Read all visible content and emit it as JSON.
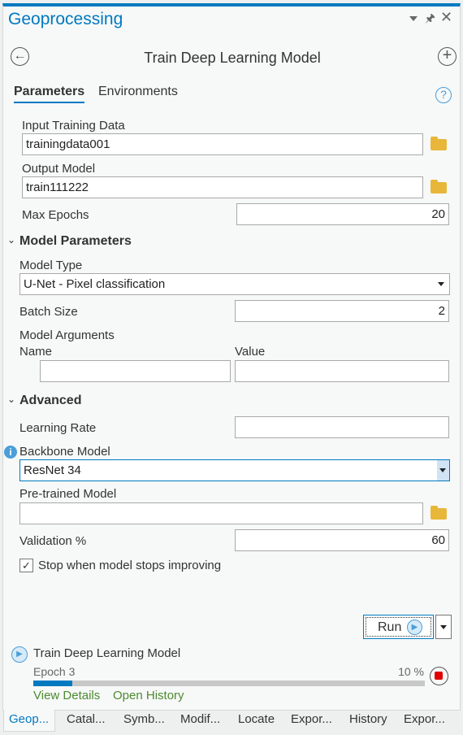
{
  "pane": {
    "title": "Geoprocessing"
  },
  "tool": {
    "title": "Train Deep Learning Model"
  },
  "tabs": {
    "parameters": "Parameters",
    "environments": "Environments"
  },
  "params": {
    "input_training_data": {
      "label": "Input Training Data",
      "value": "trainingdata001"
    },
    "output_model": {
      "label": "Output Model",
      "value": "train111222"
    },
    "max_epochs": {
      "label": "Max Epochs",
      "value": "20"
    }
  },
  "model_parameters": {
    "header": "Model Parameters",
    "model_type": {
      "label": "Model Type",
      "value": "U-Net - Pixel classification"
    },
    "batch_size": {
      "label": "Batch Size",
      "value": "2"
    },
    "model_arguments": {
      "label": "Model Arguments",
      "name_col": "Name",
      "value_col": "Value"
    }
  },
  "advanced": {
    "header": "Advanced",
    "learning_rate": {
      "label": "Learning Rate",
      "value": ""
    },
    "backbone_model": {
      "label": "Backbone Model",
      "value": "ResNet 34"
    },
    "pretrained_model": {
      "label": "Pre-trained Model",
      "value": ""
    },
    "validation": {
      "label": "Validation %",
      "value": "60"
    },
    "stop_checkbox": {
      "label": "Stop when model stops improving",
      "checked": true
    }
  },
  "run": {
    "label": "Run"
  },
  "progress": {
    "tool": "Train Deep Learning Model",
    "status": "Epoch 3",
    "percent_label": "10 %",
    "percent": 10,
    "view_details": "View Details",
    "open_history": "Open History"
  },
  "bottom_tabs": [
    "Geop...",
    "Catal...",
    "Symb...",
    "Modif...",
    "Locate",
    "Expor...",
    "History",
    "Expor..."
  ],
  "colors": {
    "accent": "#0079c1",
    "progress": "#0079c1",
    "link": "#4c8b2f",
    "stop": "#e00000"
  }
}
